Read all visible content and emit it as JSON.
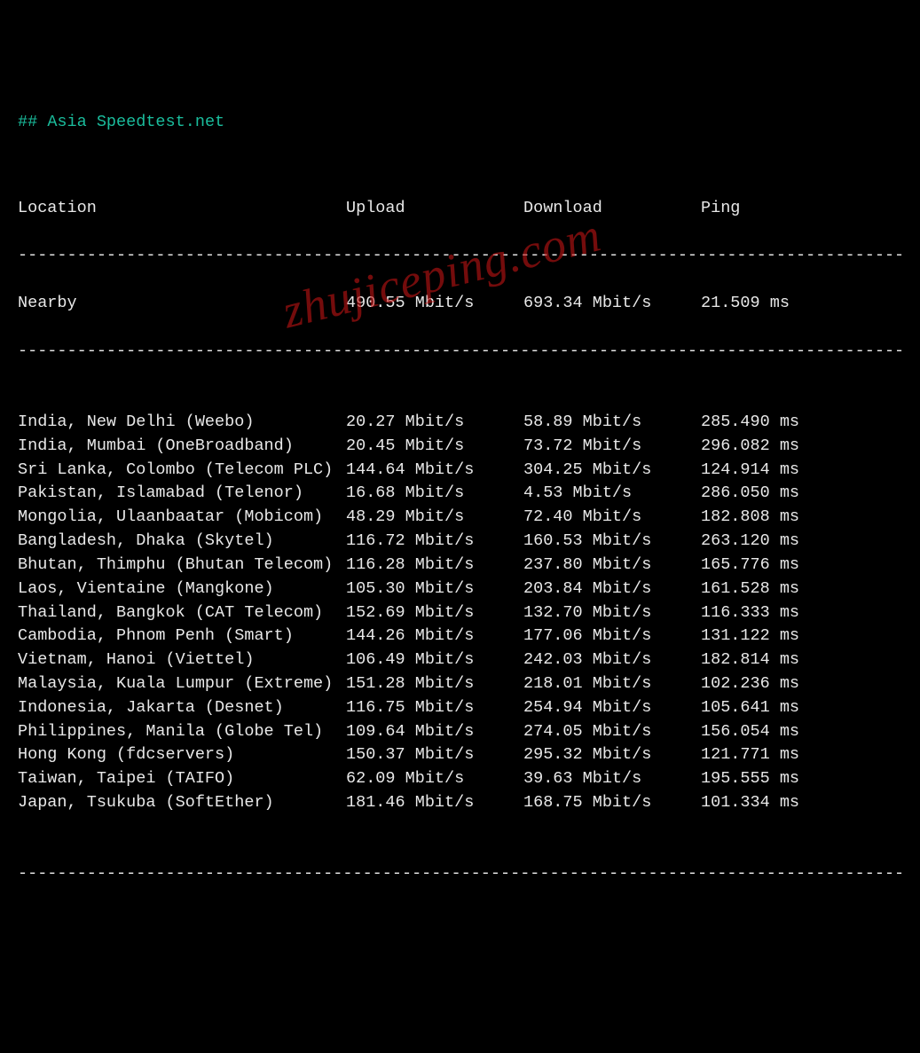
{
  "title_prefix": "## ",
  "title": "Asia Speedtest.net",
  "headers": {
    "location": "Location",
    "upload": "Upload",
    "download": "Download",
    "ping": "Ping"
  },
  "divider": "------------------------------------------------------------------------------------------",
  "unit_speed": "Mbit/s",
  "unit_ping": "ms",
  "nearby": {
    "location": "Nearby",
    "upload": "490.55 Mbit/s",
    "download": "693.34 Mbit/s",
    "ping": "21.509 ms"
  },
  "rows": [
    {
      "location": "India, New Delhi (Weebo)",
      "upload": "20.27 Mbit/s",
      "download": "58.89 Mbit/s",
      "ping": "285.490 ms"
    },
    {
      "location": "India, Mumbai (OneBroadband)",
      "upload": "20.45 Mbit/s",
      "download": "73.72 Mbit/s",
      "ping": "296.082 ms"
    },
    {
      "location": "Sri Lanka, Colombo (Telecom PLC)",
      "upload": "144.64 Mbit/s",
      "download": "304.25 Mbit/s",
      "ping": "124.914 ms"
    },
    {
      "location": "Pakistan, Islamabad (Telenor)",
      "upload": "16.68 Mbit/s",
      "download": "4.53 Mbit/s",
      "ping": "286.050 ms"
    },
    {
      "location": "Mongolia, Ulaanbaatar (Mobicom)",
      "upload": "48.29 Mbit/s",
      "download": "72.40 Mbit/s",
      "ping": "182.808 ms"
    },
    {
      "location": "Bangladesh, Dhaka (Skytel)",
      "upload": "116.72 Mbit/s",
      "download": "160.53 Mbit/s",
      "ping": "263.120 ms"
    },
    {
      "location": "Bhutan, Thimphu (Bhutan Telecom)",
      "upload": "116.28 Mbit/s",
      "download": "237.80 Mbit/s",
      "ping": "165.776 ms"
    },
    {
      "location": "Laos, Vientaine (Mangkone)",
      "upload": "105.30 Mbit/s",
      "download": "203.84 Mbit/s",
      "ping": "161.528 ms"
    },
    {
      "location": "Thailand, Bangkok (CAT Telecom)",
      "upload": "152.69 Mbit/s",
      "download": "132.70 Mbit/s",
      "ping": "116.333 ms"
    },
    {
      "location": "Cambodia, Phnom Penh (Smart)",
      "upload": "144.26 Mbit/s",
      "download": "177.06 Mbit/s",
      "ping": "131.122 ms"
    },
    {
      "location": "Vietnam, Hanoi (Viettel)",
      "upload": "106.49 Mbit/s",
      "download": "242.03 Mbit/s",
      "ping": "182.814 ms"
    },
    {
      "location": "Malaysia, Kuala Lumpur (Extreme)",
      "upload": "151.28 Mbit/s",
      "download": "218.01 Mbit/s",
      "ping": "102.236 ms"
    },
    {
      "location": "Indonesia, Jakarta (Desnet)",
      "upload": "116.75 Mbit/s",
      "download": "254.94 Mbit/s",
      "ping": "105.641 ms"
    },
    {
      "location": "Philippines, Manila (Globe Tel)",
      "upload": "109.64 Mbit/s",
      "download": "274.05 Mbit/s",
      "ping": "156.054 ms"
    },
    {
      "location": "Hong Kong (fdcservers)",
      "upload": "150.37 Mbit/s",
      "download": "295.32 Mbit/s",
      "ping": "121.771 ms"
    },
    {
      "location": "Taiwan, Taipei (TAIFO)",
      "upload": "62.09 Mbit/s",
      "download": "39.63 Mbit/s",
      "ping": "195.555 ms"
    },
    {
      "location": "Japan, Tsukuba (SoftEther)",
      "upload": "181.46 Mbit/s",
      "download": "168.75 Mbit/s",
      "ping": "101.334 ms"
    }
  ],
  "watermark": "zhujiceping.com"
}
